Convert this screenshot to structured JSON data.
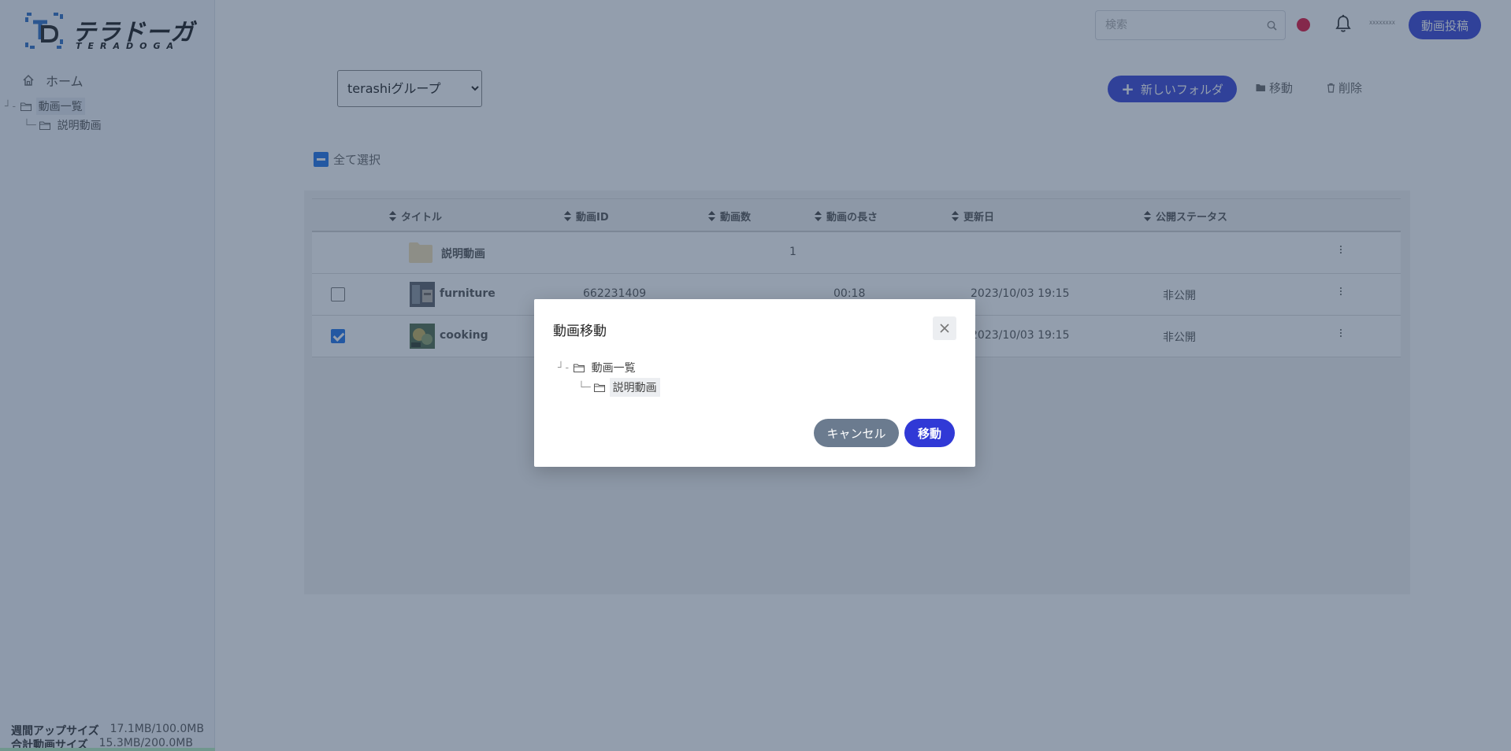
{
  "brand": {
    "name_jp": "テラドーガ",
    "name_en": "TERADOGA",
    "mark_color": "#2e6fc4"
  },
  "sidebar": {
    "home_label": "ホーム",
    "tree": {
      "root": "動画一覧",
      "child": "説明動画"
    },
    "storage": {
      "weekly_label": "週間アップサイズ",
      "weekly_value": "17.1MB/100.0MB",
      "total_label": "合計動画サイズ",
      "total_value": "15.3MB/200.0MB"
    }
  },
  "header": {
    "search_placeholder": "検索",
    "avatar_text": "XXXXXXXX",
    "post_label": "動画投稿"
  },
  "toolbar": {
    "group_selected": "terashiグループ",
    "new_folder_label": "新しいフォルダ",
    "move_label": "移動",
    "delete_label": "削除",
    "select_all_label": "全て選択"
  },
  "table": {
    "columns": [
      "タイトル",
      "動画ID",
      "動画数",
      "動画の長さ",
      "更新日",
      "公開ステータス"
    ],
    "rows": [
      {
        "type": "folder",
        "title": "説明動画",
        "id": "",
        "count": "1",
        "length": "",
        "updated": "",
        "status": ""
      },
      {
        "type": "video",
        "title": "furniture",
        "id": "662231409",
        "count": "",
        "length": "00:18",
        "updated": "2023/10/03 19:15",
        "status": "非公開",
        "checked": false
      },
      {
        "type": "video",
        "title": "cooking",
        "id": "",
        "count": "",
        "length": "",
        "updated": "2023/10/03 19:15",
        "status": "非公開",
        "checked": true
      }
    ]
  },
  "modal": {
    "title": "動画移動",
    "tree": {
      "root": "動画一覧",
      "child": "説明動画"
    },
    "cancel_label": "キャンセル",
    "move_label": "移動"
  },
  "colors": {
    "primary": "#3844d6",
    "checkbox": "#1f72e8",
    "record": "#e0123a",
    "overlay": "rgba(40,62,92,0.5)"
  }
}
